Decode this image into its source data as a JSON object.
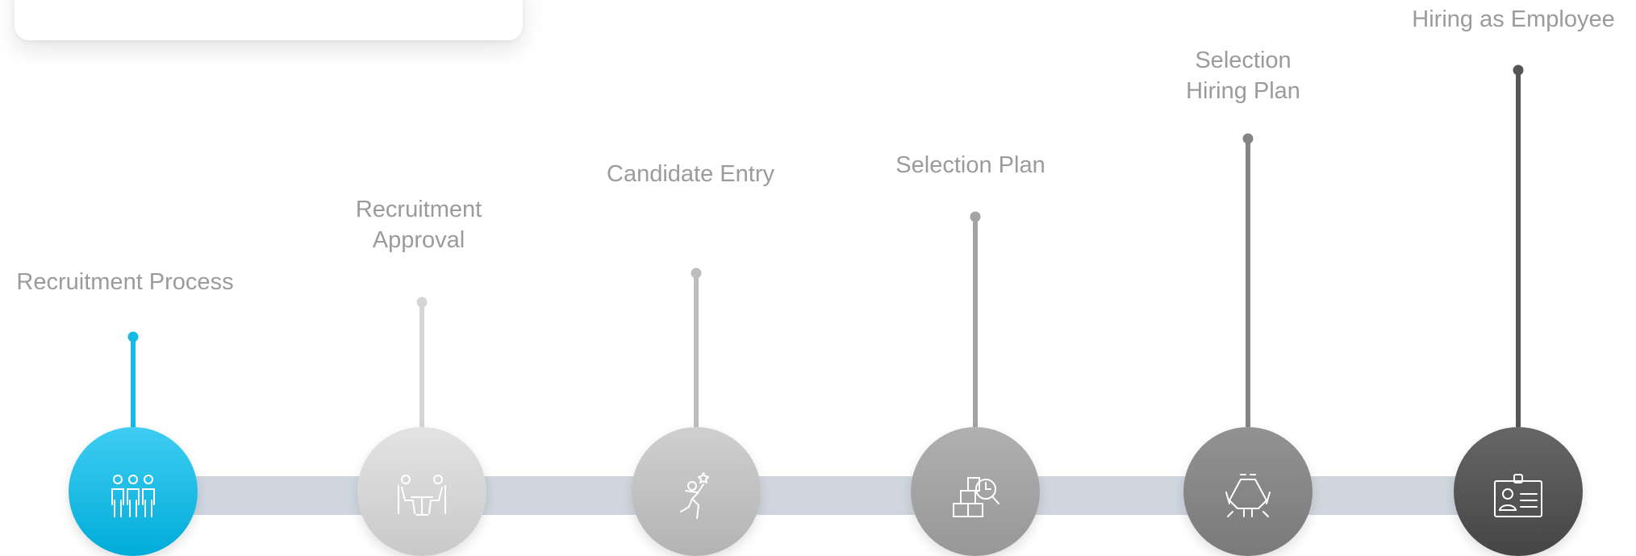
{
  "steps": [
    {
      "title": "Recruitment Process",
      "icon": "team-icon",
      "color": "#00b0e8",
      "gradient": [
        "#3fcdf2",
        "#00acd9"
      ],
      "stem_color": "#14b9e4"
    },
    {
      "title": "Recruitment Approval",
      "line1": "Recruitment",
      "line2": "Approval",
      "icon": "interview-icon",
      "color": "#d9d9d9",
      "gradient": [
        "#e3e3e3",
        "#c9c9c9"
      ],
      "stem_color": "#d5d5d5"
    },
    {
      "title": "Candidate Entry",
      "icon": "success-person-icon",
      "color": "#c4c4c4",
      "gradient": [
        "#cfcfcf",
        "#b3b3b3"
      ],
      "stem_color": "#bdbdbd"
    },
    {
      "title": "Selection Plan",
      "icon": "planning-icon",
      "color": "#a6a6a6",
      "gradient": [
        "#b0b0b0",
        "#979797"
      ],
      "stem_color": "#a3a3a3"
    },
    {
      "title": "Selection Hiring Plan",
      "line1": "Selection",
      "line2": "Hiring Plan",
      "icon": "meeting-table-icon",
      "color": "#8a8a8a",
      "gradient": [
        "#929292",
        "#7a7a7a"
      ],
      "stem_color": "#858585"
    },
    {
      "title": "Hiring as Employee",
      "icon": "id-badge-icon",
      "color": "#5a5a5a",
      "gradient": [
        "#666666",
        "#454545"
      ],
      "stem_color": "#555555"
    }
  ]
}
